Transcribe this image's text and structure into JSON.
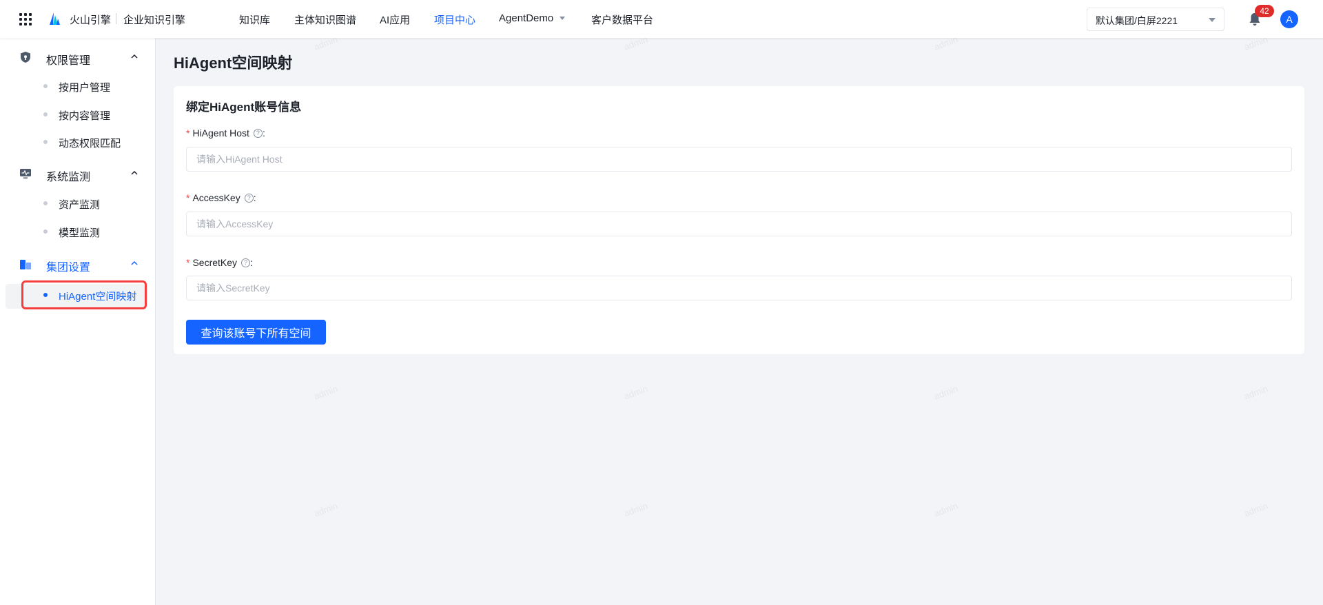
{
  "header": {
    "brand_name": "火山引擎",
    "brand_sub": "企业知识引擎",
    "nav": [
      {
        "label": "知识库",
        "active": false
      },
      {
        "label": "主体知识图谱",
        "active": false
      },
      {
        "label": "AI应用",
        "active": false
      },
      {
        "label": "项目中心",
        "active": true
      },
      {
        "label": "AgentDemo",
        "active": false,
        "dropdown": true
      },
      {
        "label": "客户数据平台",
        "active": false
      }
    ],
    "tenant_select": "默认集团/白屏2221",
    "notification_count": "42",
    "avatar_initial": "A",
    "accent_color": "#1664ff"
  },
  "sidebar": {
    "groups": [
      {
        "label": "权限管理",
        "icon": "shield-icon",
        "expanded": true,
        "items": [
          {
            "label": "按用户管理"
          },
          {
            "label": "按内容管理"
          },
          {
            "label": "动态权限匹配"
          }
        ]
      },
      {
        "label": "系统监测",
        "icon": "monitor-icon",
        "expanded": true,
        "items": [
          {
            "label": "资产监测"
          },
          {
            "label": "模型监测"
          }
        ]
      },
      {
        "label": "集团设置",
        "icon": "building-icon",
        "expanded": true,
        "active": true,
        "items": [
          {
            "label": "HiAgent空间映射",
            "active": true
          }
        ]
      }
    ]
  },
  "main": {
    "page_title": "HiAgent空间映射",
    "card_title": "绑定HiAgent账号信息",
    "fields": [
      {
        "label": "HiAgent Host",
        "required": true,
        "placeholder": "请输入HiAgent Host",
        "value": ""
      },
      {
        "label": "AccessKey",
        "required": true,
        "placeholder": "请输入AccessKey",
        "value": ""
      },
      {
        "label": "SecretKey",
        "required": true,
        "placeholder": "请输入SecretKey",
        "value": ""
      }
    ],
    "required_mark": "*",
    "help_glyph": "?",
    "label_colon": ":",
    "submit_label": "查询该账号下所有空间"
  },
  "watermark": "admin"
}
